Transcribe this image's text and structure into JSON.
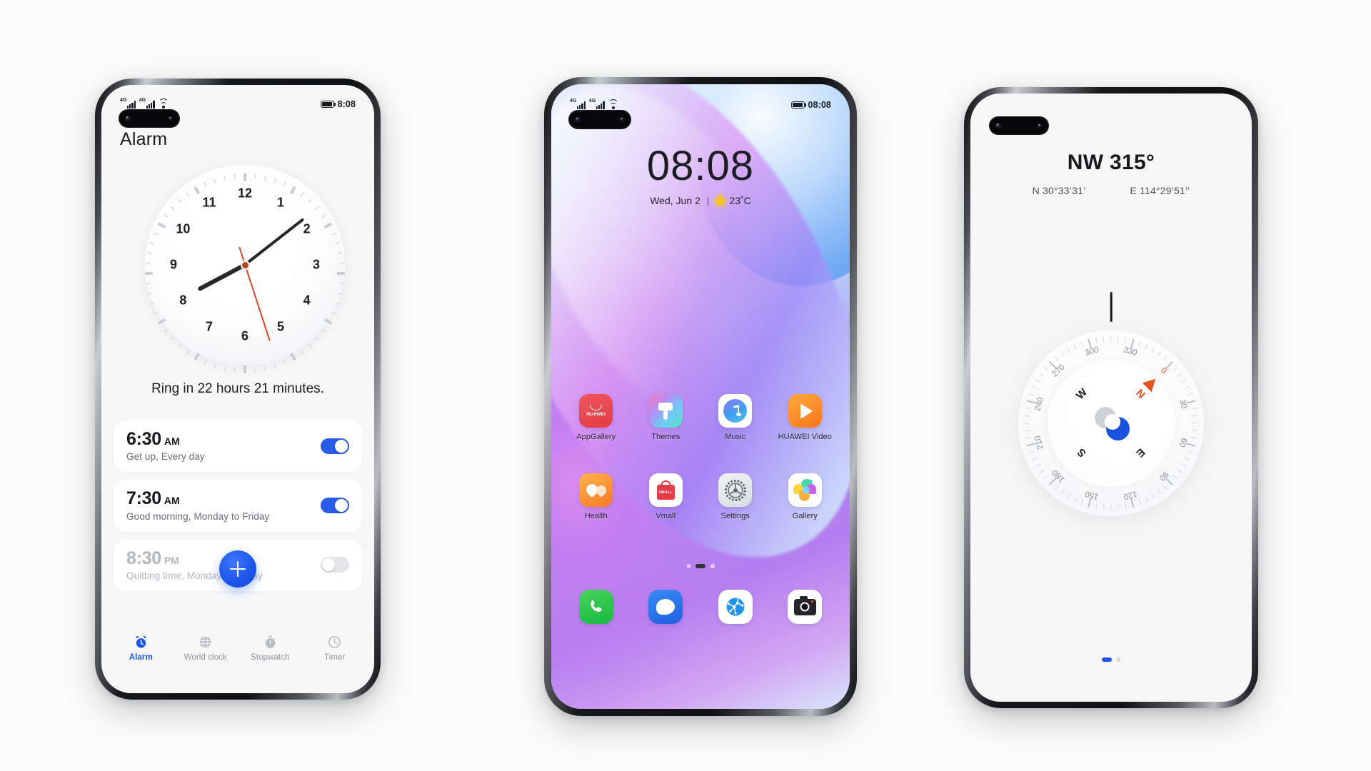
{
  "page": {
    "background": "#fbfbfb"
  },
  "colors": {
    "accent_blue": "#1c56e8",
    "toggle_on": "#2a5ae8",
    "compass_orange": "#e2521c",
    "second_hand": "#d94826"
  },
  "phone_alarm": {
    "device_name": "huawei-phone-alarm",
    "statusbar": {
      "signal1": "4G",
      "signal2": "4G",
      "wifi_icon": "wifi-icon",
      "battery_icon": "battery-icon",
      "time": "8:08"
    },
    "page_title": "Alarm",
    "clock": {
      "numerals": [
        "12",
        "1",
        "2",
        "3",
        "4",
        "5",
        "6",
        "7",
        "8",
        "9",
        "10",
        "11"
      ],
      "hour_angle": 242,
      "minute_angle": 52,
      "second_angle": 162
    },
    "ring_text": "Ring in 22 hours 21 minutes.",
    "alarms": [
      {
        "time": "6:30",
        "meridiem": "AM",
        "label": "Get up, Every day",
        "enabled": true
      },
      {
        "time": "7:30",
        "meridiem": "AM",
        "label": "Good morning, Monday to Friday",
        "enabled": true
      },
      {
        "time": "8:30",
        "meridiem": "PM",
        "label": "Quitting time, Monday to Friday",
        "enabled": false
      }
    ],
    "add_button": {
      "icon": "plus-icon",
      "label": "Add alarm"
    },
    "tabs": [
      {
        "label": "Alarm",
        "icon": "alarm-clock-icon",
        "active": true
      },
      {
        "label": "World clock",
        "icon": "globe-icon",
        "active": false
      },
      {
        "label": "Stopwatch",
        "icon": "stopwatch-icon",
        "active": false
      },
      {
        "label": "Timer",
        "icon": "timer-icon",
        "active": false
      }
    ]
  },
  "phone_home": {
    "device_name": "huawei-phone-home",
    "statusbar": {
      "signal1": "4G",
      "signal2": "4G",
      "wifi_icon": "wifi-icon",
      "battery_icon": "battery-icon",
      "time": "08:08"
    },
    "lockscreen": {
      "time": "08:08",
      "date": "Wed, Jun 2",
      "divider": "|",
      "weather_icon": "sun-icon",
      "temperature": "23˚C"
    },
    "apps_row1": [
      {
        "label": "AppGallery",
        "icon": "appgallery-icon"
      },
      {
        "label": "Themes",
        "icon": "themes-icon"
      },
      {
        "label": "Music",
        "icon": "music-icon"
      },
      {
        "label": "HUAWEI Video",
        "icon": "huawei-video-icon"
      }
    ],
    "apps_row2": [
      {
        "label": "Health",
        "icon": "health-icon"
      },
      {
        "label": "Vmall",
        "icon": "vmall-icon"
      },
      {
        "label": "Settings",
        "icon": "settings-gear-icon"
      },
      {
        "label": "Gallery",
        "icon": "gallery-icon"
      }
    ],
    "page_dots": {
      "count": 3,
      "active_index": 1
    },
    "dock": [
      {
        "label": "Phone",
        "icon": "phone-icon"
      },
      {
        "label": "Messages",
        "icon": "messages-icon"
      },
      {
        "label": "Browser",
        "icon": "browser-globe-icon"
      },
      {
        "label": "Camera",
        "icon": "camera-icon"
      }
    ]
  },
  "phone_compass": {
    "device_name": "huawei-phone-compass",
    "heading": "NW 315°",
    "latitude": "N 30°33’31’",
    "longitude": "E 114°29’51’’",
    "dial": {
      "rotation_deg": -315,
      "degree_labels": [
        "0",
        "30",
        "60",
        "90",
        "120",
        "150",
        "180",
        "210",
        "240",
        "270",
        "300",
        "330"
      ],
      "cardinals": [
        "N",
        "E",
        "S",
        "W"
      ],
      "north_arrow_icon": "north-arrow-icon"
    },
    "page_dots": {
      "count": 2,
      "active_index": 0
    }
  }
}
